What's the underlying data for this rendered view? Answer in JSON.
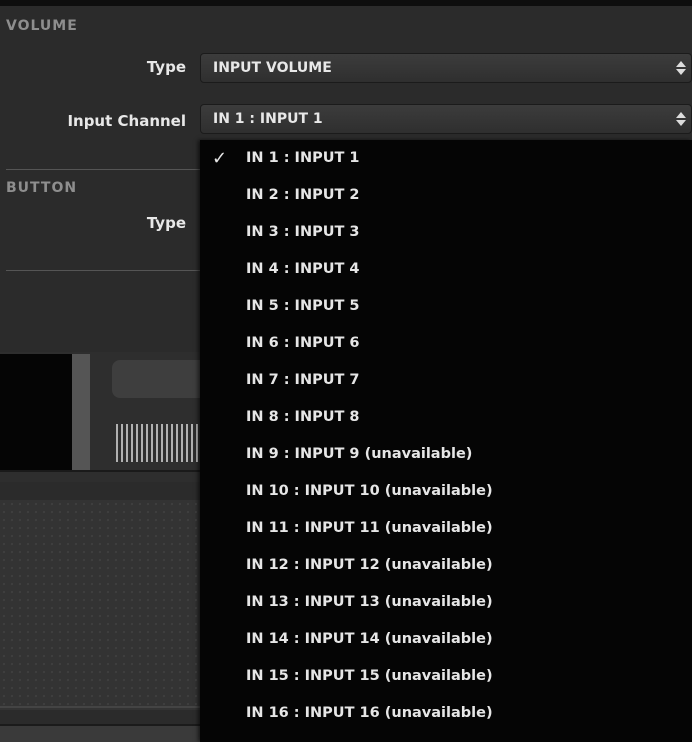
{
  "volume": {
    "header": "VOLUME",
    "type_label": "Type",
    "type_value": "INPUT VOLUME",
    "channel_label": "Input Channel",
    "channel_value": "IN 1 : INPUT 1"
  },
  "button": {
    "header": "BUTTON",
    "type_label": "Type"
  },
  "dropdown": {
    "selected_index": 0,
    "items": [
      "IN 1 : INPUT 1",
      "IN 2 : INPUT 2",
      "IN 3 : INPUT 3",
      "IN 4 : INPUT 4",
      "IN 5 : INPUT 5",
      "IN 6 : INPUT 6",
      "IN 7 : INPUT 7",
      "IN 8 : INPUT 8",
      "IN 9 : INPUT 9 (unavailable)",
      "IN 10 : INPUT 10 (unavailable)",
      "IN 11 : INPUT 11 (unavailable)",
      "IN 12 : INPUT 12 (unavailable)",
      "IN 13 : INPUT 13 (unavailable)",
      "IN 14 : INPUT 14 (unavailable)",
      "IN 15 : INPUT 15 (unavailable)",
      "IN 16 : INPUT 16 (unavailable)"
    ]
  },
  "icons": {
    "select_arrows": "up-down-arrows-icon",
    "checkmark": "checkmark-icon"
  },
  "colors": {
    "background": "#2b2b2b",
    "dropdown_bg": "#050505",
    "text": "#e6e6e6",
    "header_text": "#8e8e8e"
  }
}
